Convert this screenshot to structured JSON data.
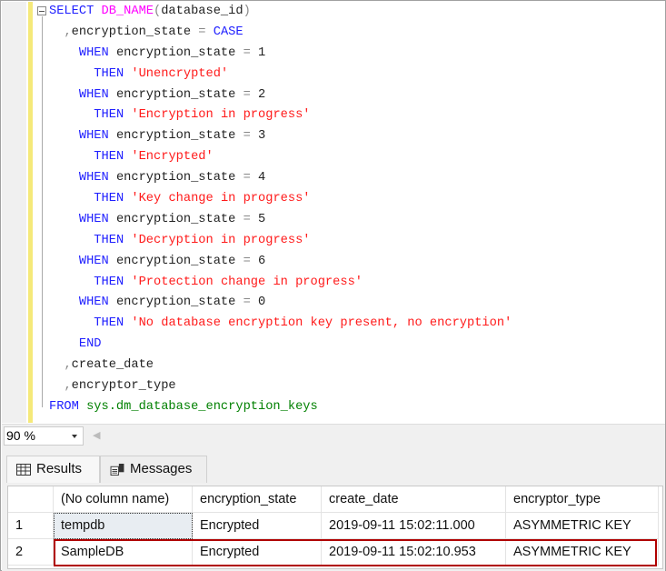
{
  "editor": {
    "lines": [
      [
        [
          "kw",
          "SELECT "
        ],
        [
          "fn",
          "DB_NAME"
        ],
        [
          "gr",
          "("
        ],
        [
          "",
          "database_id"
        ],
        [
          "gr",
          ")"
        ]
      ],
      [
        [
          "",
          "  "
        ],
        [
          "gr",
          ","
        ],
        [
          "",
          "encryption_state "
        ],
        [
          "gr",
          "= "
        ],
        [
          "kw",
          "CASE"
        ]
      ],
      [
        [
          "",
          "    "
        ],
        [
          "kw",
          "WHEN "
        ],
        [
          "",
          "encryption_state "
        ],
        [
          "gr",
          "= "
        ],
        [
          "",
          "1"
        ]
      ],
      [
        [
          "",
          "      "
        ],
        [
          "kw",
          "THEN "
        ],
        [
          "st",
          "'Unencrypted'"
        ]
      ],
      [
        [
          "",
          "    "
        ],
        [
          "kw",
          "WHEN "
        ],
        [
          "",
          "encryption_state "
        ],
        [
          "gr",
          "= "
        ],
        [
          "",
          "2"
        ]
      ],
      [
        [
          "",
          "      "
        ],
        [
          "kw",
          "THEN "
        ],
        [
          "st",
          "'Encryption in progress'"
        ]
      ],
      [
        [
          "",
          "    "
        ],
        [
          "kw",
          "WHEN "
        ],
        [
          "",
          "encryption_state "
        ],
        [
          "gr",
          "= "
        ],
        [
          "",
          "3"
        ]
      ],
      [
        [
          "",
          "      "
        ],
        [
          "kw",
          "THEN "
        ],
        [
          "st",
          "'Encrypted'"
        ]
      ],
      [
        [
          "",
          "    "
        ],
        [
          "kw",
          "WHEN "
        ],
        [
          "",
          "encryption_state "
        ],
        [
          "gr",
          "= "
        ],
        [
          "",
          "4"
        ]
      ],
      [
        [
          "",
          "      "
        ],
        [
          "kw",
          "THEN "
        ],
        [
          "st",
          "'Key change in progress'"
        ]
      ],
      [
        [
          "",
          "    "
        ],
        [
          "kw",
          "WHEN "
        ],
        [
          "",
          "encryption_state "
        ],
        [
          "gr",
          "= "
        ],
        [
          "",
          "5"
        ]
      ],
      [
        [
          "",
          "      "
        ],
        [
          "kw",
          "THEN "
        ],
        [
          "st",
          "'Decryption in progress'"
        ]
      ],
      [
        [
          "",
          "    "
        ],
        [
          "kw",
          "WHEN "
        ],
        [
          "",
          "encryption_state "
        ],
        [
          "gr",
          "= "
        ],
        [
          "",
          "6"
        ]
      ],
      [
        [
          "",
          "      "
        ],
        [
          "kw",
          "THEN "
        ],
        [
          "st",
          "'Protection change in progress'"
        ]
      ],
      [
        [
          "",
          "    "
        ],
        [
          "kw",
          "WHEN "
        ],
        [
          "",
          "encryption_state "
        ],
        [
          "gr",
          "= "
        ],
        [
          "",
          "0"
        ]
      ],
      [
        [
          "",
          "      "
        ],
        [
          "kw",
          "THEN "
        ],
        [
          "st",
          "'No database encryption key present, no encryption'"
        ]
      ],
      [
        [
          "",
          "    "
        ],
        [
          "kw",
          "END"
        ]
      ],
      [
        [
          "",
          "  "
        ],
        [
          "gr",
          ","
        ],
        [
          "",
          "create_date"
        ]
      ],
      [
        [
          "",
          "  "
        ],
        [
          "gr",
          ","
        ],
        [
          "",
          "encryptor_type"
        ]
      ],
      [
        [
          "kw",
          "FROM "
        ],
        [
          "sy",
          "sys.dm_database_encryption_keys"
        ]
      ]
    ]
  },
  "zoom": {
    "value": "90 %"
  },
  "tabs": {
    "results": "Results",
    "messages": "Messages"
  },
  "grid": {
    "columns": [
      "",
      "(No column name)",
      "encryption_state",
      "create_date",
      "encryptor_type"
    ],
    "rows": [
      [
        "1",
        "tempdb",
        "Encrypted",
        "2019-09-11 15:02:11.000",
        "ASYMMETRIC KEY"
      ],
      [
        "2",
        "SampleDB",
        "Encrypted",
        "2019-09-11 15:02:10.953",
        "ASYMMETRIC KEY"
      ]
    ]
  },
  "colors": {
    "keyword": "#2020ff",
    "function": "#ff00ff",
    "string": "#ff1a1a",
    "system": "#008000",
    "highlight": "#b00000"
  }
}
